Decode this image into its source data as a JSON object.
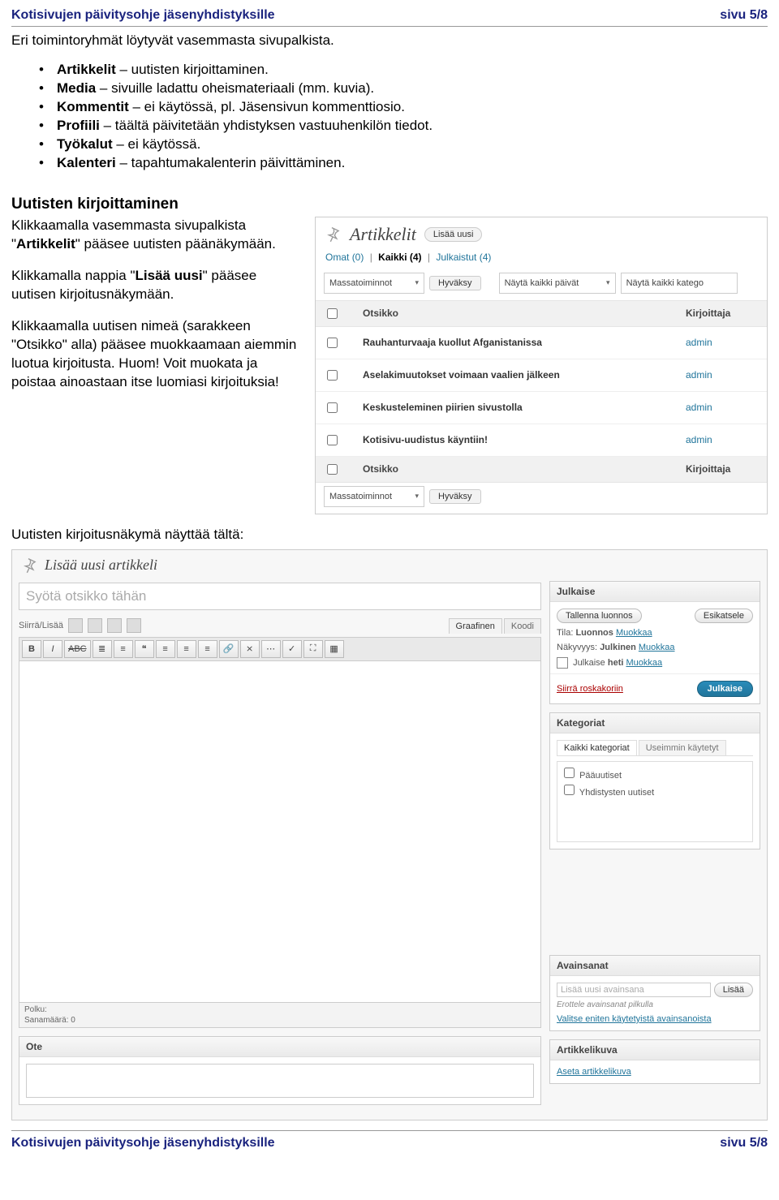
{
  "header": {
    "title": "Kotisivujen päivitysohje jäsenyhdistyksille",
    "page": "sivu 5/8"
  },
  "footer": {
    "title": "Kotisivujen päivitysohje jäsenyhdistyksille",
    "page": "sivu 5/8"
  },
  "intro": "Eri toimintoryhmät löytyvät vasemmasta sivupalkista.",
  "bullets": [
    {
      "bold": "Artikkelit",
      "rest": " – uutisten kirjoittaminen."
    },
    {
      "bold": "Media",
      "rest": " – sivuille ladattu oheismateriaali (mm. kuvia)."
    },
    {
      "bold": "Kommentit",
      "rest": " – ei käytössä, pl. Jäsensivun kommenttiosio."
    },
    {
      "bold": "Profiili",
      "rest": " – täältä päivitetään yhdistyksen vastuuhenkilön tiedot."
    },
    {
      "bold": "Työkalut",
      "rest": " – ei käytössä."
    },
    {
      "bold": "Kalenteri",
      "rest": " – tapahtumakalenterin päivittäminen."
    }
  ],
  "section_title": "Uutisten kirjoittaminen",
  "para1": {
    "pre": "Klikkaamalla vasemmasta sivu­palkista \"",
    "bold": "Artikkelit",
    "post": "\" pääsee uutisten päänäkymään."
  },
  "para2": {
    "pre": "Klikkamalla nappia \"",
    "bold": "Lisää uusi",
    "post": "\" pääsee uutisen kirjoitus­näkymään."
  },
  "para3": "Klikkaamalla uutisen nimeä (sarakkeen \"Otsikko\" alla) pää­see muokkaamaan aiemmin luotua kirjoitusta. Huom! Voit muokata ja poistaa ainoastaan itse luomiasi kirjoituksia!",
  "para4": "Uutisten kirjoitusnäkymä näyttää tältä:",
  "wp_list": {
    "heading": "Artikkelit",
    "add_btn": "Lisää uusi",
    "filters": {
      "own_label": "Omat",
      "own_count": "(0)",
      "all_label": "Kaikki",
      "all_count": "(4)",
      "pub_label": "Julkaistut",
      "pub_count": "(4)"
    },
    "bulk_label": "Massatoiminnot",
    "apply_label": "Hyväksy",
    "date_filter": "Näytä kaikki päivät",
    "cat_filter": "Näytä kaikki katego",
    "col_title": "Otsikko",
    "col_author": "Kirjoittaja",
    "rows": [
      {
        "title": "Rauhanturvaaja kuollut Afganistanissa",
        "author": "admin"
      },
      {
        "title": "Aselakimuutokset voimaan vaalien jälkeen",
        "author": "admin"
      },
      {
        "title": "Keskusteleminen piirien sivustolla",
        "author": "admin"
      },
      {
        "title": "Kotisivu-uudistus käyntiin!",
        "author": "admin"
      }
    ]
  },
  "editor": {
    "heading": "Lisää uusi artikkeli",
    "title_placeholder": "Syötä otsikko tähän",
    "media_label": "Siirrä/Lisää",
    "tab_visual": "Graafinen",
    "tab_html": "Koodi",
    "path_label": "Polku:",
    "wordcount_label": "Sanamäärä: 0",
    "excerpt_label": "Ote",
    "publish": {
      "title": "Julkaise",
      "save_draft": "Tallenna luonnos",
      "preview": "Esikatsele",
      "status_label": "Tila:",
      "status_value": "Luonnos",
      "status_edit": "Muokkaa",
      "vis_label": "Näkyvyys:",
      "vis_value": "Julkinen",
      "vis_edit": "Muokkaa",
      "sched_label": "Julkaise",
      "sched_value": "heti",
      "sched_edit": "Muokkaa",
      "trash": "Siirrä roskakoriin",
      "publish_btn": "Julkaise"
    },
    "categories": {
      "title": "Kategoriat",
      "tab_all": "Kaikki kategoriat",
      "tab_used": "Useimmin käytetyt",
      "items": [
        "Pääuutiset",
        "Yhdistysten uutiset"
      ]
    },
    "tags": {
      "title": "Avainsanat",
      "placeholder": "Lisää uusi avainsana",
      "add_btn": "Lisää",
      "hint": "Erottele avainsanat pilkulla",
      "popular": "Valitse eniten käytetyistä avainsanoista"
    },
    "thumb": {
      "title": "Artikkelikuva",
      "set_link": "Aseta artikkelikuva"
    }
  }
}
